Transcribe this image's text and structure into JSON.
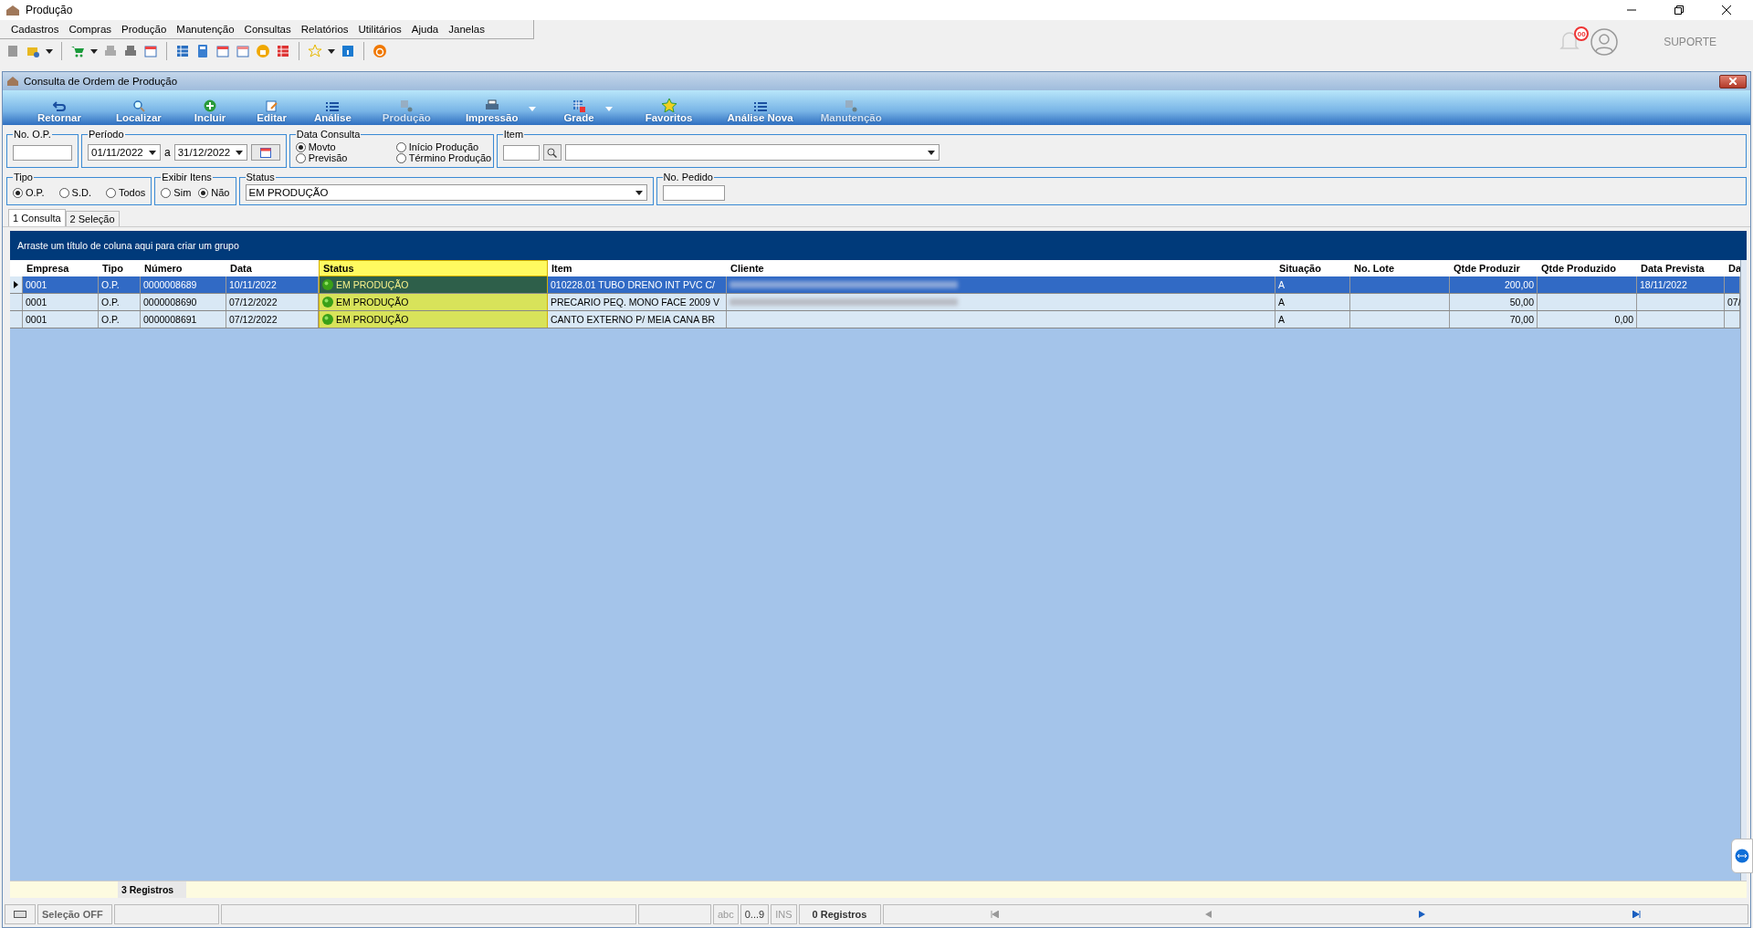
{
  "window": {
    "title": "Produção"
  },
  "menu": [
    "Cadastros",
    "Compras",
    "Produção",
    "Manutenção",
    "Consultas",
    "Relatórios",
    "Utilitários",
    "Ajuda",
    "Janelas"
  ],
  "header_right": {
    "notifications": "00",
    "user_label": "SUPORTE"
  },
  "child_window": {
    "title": "Consulta de Ordem de Produção"
  },
  "ribbon": [
    {
      "label": "Retornar",
      "disabled": false,
      "dropdown": false
    },
    {
      "label": "Localizar",
      "disabled": false,
      "dropdown": false
    },
    {
      "label": "Incluir",
      "disabled": false,
      "dropdown": false
    },
    {
      "label": "Editar",
      "disabled": false,
      "dropdown": false
    },
    {
      "label": "Análise",
      "disabled": false,
      "dropdown": false
    },
    {
      "label": "Produção",
      "disabled": true,
      "dropdown": false
    },
    {
      "label": "Impressão",
      "disabled": false,
      "dropdown": true
    },
    {
      "label": "Grade",
      "disabled": false,
      "dropdown": true
    },
    {
      "label": "Favoritos",
      "disabled": false,
      "dropdown": false
    },
    {
      "label": "Análise Nova",
      "disabled": false,
      "dropdown": false
    },
    {
      "label": "Manutenção",
      "disabled": true,
      "dropdown": false
    }
  ],
  "filters": {
    "no_op": {
      "label": "No. O.P."
    },
    "periodo": {
      "label": "Período",
      "from": "01/11/2022",
      "separator": "a",
      "to": "31/12/2022"
    },
    "data_consulta": {
      "label": "Data Consulta",
      "options": [
        {
          "label": "Movto",
          "selected": true
        },
        {
          "label": "Previsão",
          "selected": false
        },
        {
          "label": "Início Produção",
          "selected": false
        },
        {
          "label": "Término Produção",
          "selected": false
        }
      ]
    },
    "item": {
      "label": "Item"
    },
    "tipo": {
      "label": "Tipo",
      "options": [
        {
          "label": "O.P.",
          "selected": true
        },
        {
          "label": "S.D.",
          "selected": false
        },
        {
          "label": "Todos",
          "selected": false
        }
      ]
    },
    "exibir_itens": {
      "label": "Exibir Itens",
      "options": [
        {
          "label": "Sim",
          "selected": false
        },
        {
          "label": "Não",
          "selected": true
        }
      ]
    },
    "status": {
      "label": "Status",
      "value": "EM PRODUÇÃO"
    },
    "no_pedido": {
      "label": "No. Pedido"
    }
  },
  "tabs": [
    {
      "label": "1 Consulta",
      "selected": true
    },
    {
      "label": "2 Seleção",
      "selected": false
    }
  ],
  "group_hint": "Arraste um título de coluna aqui para criar um grupo",
  "table": {
    "columns": [
      {
        "label": "Empresa",
        "kind": "text"
      },
      {
        "label": "Tipo",
        "kind": "text"
      },
      {
        "label": "Número",
        "kind": "text"
      },
      {
        "label": "Data",
        "kind": "text"
      },
      {
        "label": "Status",
        "kind": "status"
      },
      {
        "label": "Item",
        "kind": "text"
      },
      {
        "label": "Cliente",
        "kind": "client"
      },
      {
        "label": "Situação",
        "kind": "text"
      },
      {
        "label": "No. Lote",
        "kind": "text"
      },
      {
        "label": "Qtde Produzir",
        "kind": "number"
      },
      {
        "label": "Qtde Produzido",
        "kind": "number"
      },
      {
        "label": "Data Prevista",
        "kind": "text"
      },
      {
        "label": "Da",
        "kind": "text"
      }
    ],
    "rows": [
      {
        "selected": true,
        "client_blurred": true,
        "cells": [
          "0001",
          "O.P.",
          "0000008689",
          "10/11/2022",
          "EM PRODUÇÃO",
          "010228.01 TUBO DRENO INT PVC C/",
          null,
          "A",
          null,
          "200,00",
          null,
          "18/11/2022",
          null
        ]
      },
      {
        "selected": false,
        "client_blurred": true,
        "cells": [
          "0001",
          "O.P.",
          "0000008690",
          "07/12/2022",
          "EM PRODUÇÃO",
          "PRECARIO PEQ. MONO FACE 2009 V",
          null,
          "A",
          null,
          "50,00",
          null,
          null,
          "07/"
        ]
      },
      {
        "selected": false,
        "client_blurred": false,
        "cells": [
          "0001",
          "O.P.",
          "0000008691",
          "07/12/2022",
          "EM PRODUÇÃO",
          "CANTO EXTERNO P/ MEIA CANA BR",
          null,
          "A",
          null,
          "70,00",
          "0,00",
          null,
          null
        ]
      }
    ],
    "footer_count": "3 Registros"
  },
  "status_bar": {
    "selection": "Seleção OFF",
    "abc": "abc",
    "digits": "0...9",
    "ins": "INS",
    "records": "0 Registros"
  }
}
